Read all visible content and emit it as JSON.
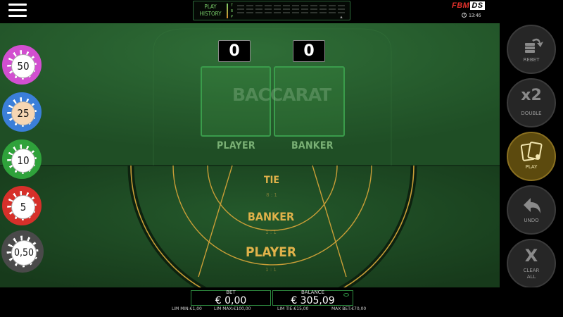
{
  "play_history": {
    "line1": "PLAY",
    "line2": "HISTORY",
    "tbp": [
      "T",
      "B",
      "P"
    ]
  },
  "brand": {
    "fbm": "FBM",
    "ds": "DS"
  },
  "clock": "13:46",
  "scores": {
    "player": "0",
    "banker": "0"
  },
  "logo": "BACCARAT",
  "hands": {
    "player": "PLAYER",
    "banker": "BANKER"
  },
  "bets": [
    {
      "label": "TIE",
      "odds": "8 : 1"
    },
    {
      "label": "BANKER",
      "odds": "1 : 1"
    },
    {
      "label": "PLAYER",
      "odds": "1 : 1"
    }
  ],
  "chips": [
    {
      "value": "50",
      "color": "#d24fd0"
    },
    {
      "value": "25",
      "color": "#3b7fd9",
      "selected": true
    },
    {
      "value": "10",
      "color": "#2fa23b"
    },
    {
      "value": "5",
      "color": "#d6302a"
    },
    {
      "value": "0,50",
      "color": "#4a4a4a"
    }
  ],
  "controls": {
    "rebet": "REBET",
    "double_big": "x2",
    "double": "DOUBLE",
    "play": "PLAY",
    "undo": "UNDO",
    "clear_big": "X",
    "clear_line1": "CLEAR",
    "clear_line2": "ALL"
  },
  "bottom": {
    "bet_label": "BET",
    "bet_value": "€ 0,00",
    "balance_label": "BALANCE",
    "balance_value": "€ 305,09",
    "limits": {
      "lim_min": "LIM MIN:€1,00",
      "lim_max": "LIM MAX:€100,00",
      "lim_tie": "LIM TIE:€15,00",
      "max_bet": "MAX BET:€70,00"
    }
  },
  "colors": {
    "felt": "#1e4a23",
    "felt_light": "#2c6a34",
    "gold": "#e0b24a",
    "accent_green": "#2e8c40"
  }
}
